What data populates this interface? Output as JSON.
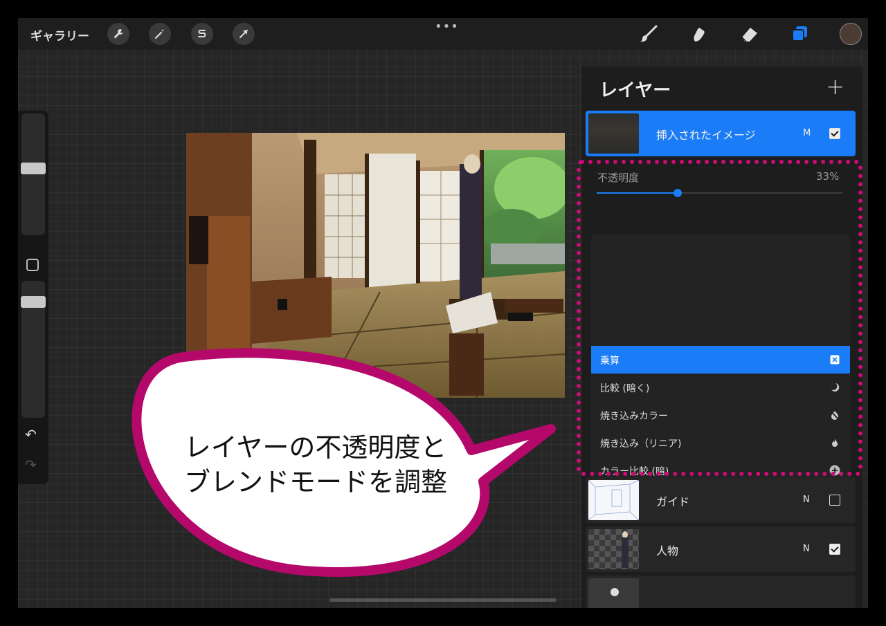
{
  "toolbar": {
    "gallery_label": "ギャラリー",
    "left_icons": [
      "wrench-icon",
      "magic-wand-icon",
      "selection-icon",
      "transform-arrow-icon"
    ],
    "more_label": "•••",
    "right_icons": [
      "brush-icon",
      "smudge-icon",
      "eraser-icon",
      "layers-icon"
    ],
    "current_color": "#4a3b33",
    "accent": "#1a7cf7"
  },
  "layers_panel": {
    "title": "レイヤー",
    "add_label": "+",
    "active_layer": {
      "name": "挿入されたイメージ",
      "mode": "M",
      "visible": true
    },
    "opacity": {
      "label": "不透明度",
      "value_text": "33%",
      "value": 0.33
    },
    "blend_modes": [
      {
        "label": "乗算",
        "selected": true,
        "icon": "multiply-icon"
      },
      {
        "label": "比較 (暗く)",
        "selected": false,
        "icon": "moon-icon"
      },
      {
        "label": "焼き込みカラー",
        "selected": false,
        "icon": "burn-icon"
      },
      {
        "label": "焼き込み（リニア)",
        "selected": false,
        "icon": "flame-icon"
      },
      {
        "label": "カラー比較 (暗)",
        "selected": false,
        "icon": "plus-circle-icon"
      }
    ],
    "layers": [
      {
        "name": "ガイド",
        "mode": "N",
        "visible": false
      },
      {
        "name": "人物",
        "mode": "N",
        "visible": true
      }
    ]
  },
  "callout": {
    "line1": "レイヤーの不透明度と",
    "line2": "ブレンドモードを調整",
    "highlight_color": "#d10a7a"
  }
}
